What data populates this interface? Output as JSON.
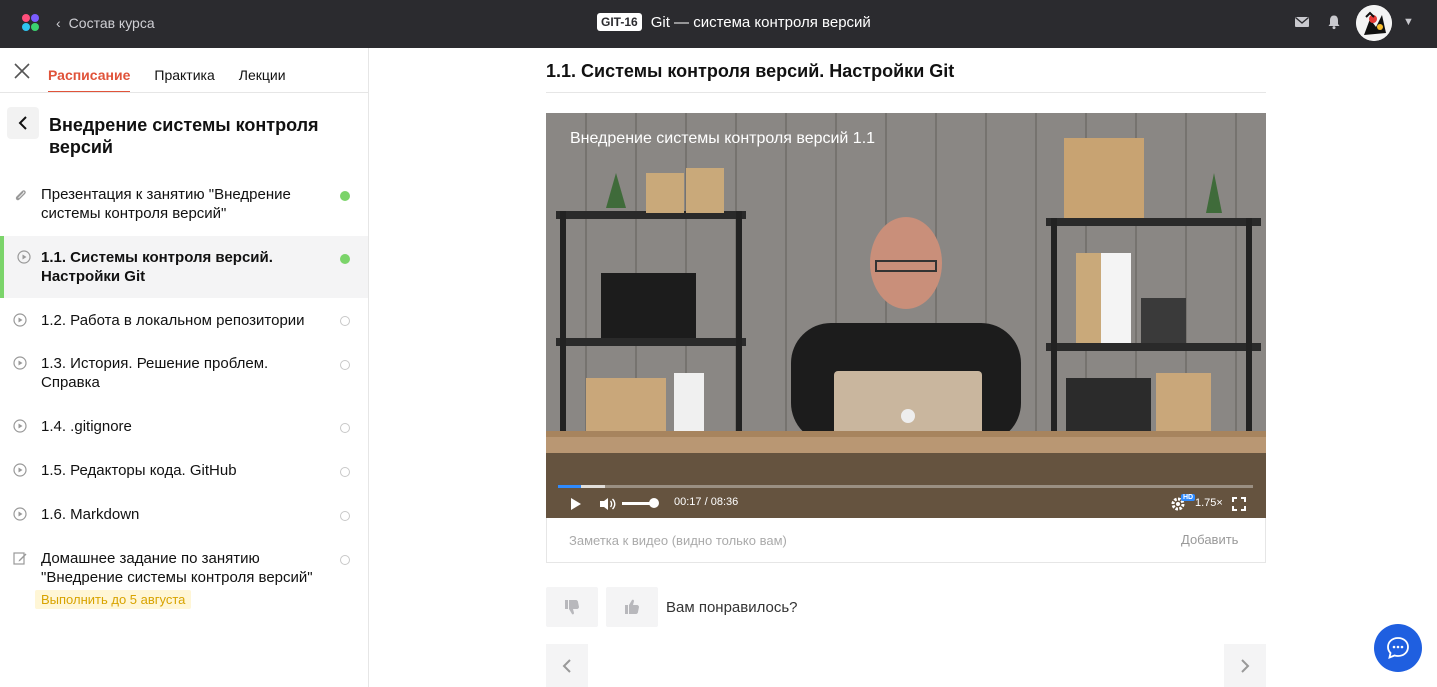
{
  "topbar": {
    "back_label": "Состав курса",
    "course_code": "GIT-16",
    "course_title": "Git — система контроля версий",
    "icons": [
      "logo-icon",
      "mail-icon",
      "bell-icon",
      "avatar",
      "chevron-down-icon"
    ]
  },
  "sidebar": {
    "tabs": [
      {
        "label": "Расписание",
        "active": true
      },
      {
        "label": "Практика",
        "active": false
      },
      {
        "label": "Лекции",
        "active": false
      }
    ],
    "section_title": "Внедрение системы контроля версий",
    "lessons": [
      {
        "label": "Презентация к занятию \"Внедрение системы контроля версий\"",
        "icon": "paperclip-icon",
        "status": "done"
      },
      {
        "label": "1.1. Системы контроля версий. Настройки Git",
        "icon": "play-icon",
        "status": "done",
        "active": true
      },
      {
        "label": "1.2. Работа в локальном репозитории",
        "icon": "play-icon",
        "status": "todo"
      },
      {
        "label": "1.3. История. Решение проблем. Справка",
        "icon": "play-icon",
        "status": "todo"
      },
      {
        "label": "1.4. .gitignore",
        "icon": "play-icon",
        "status": "todo"
      },
      {
        "label": "1.5. Редакторы кода. GitHub",
        "icon": "play-icon",
        "status": "todo"
      },
      {
        "label": "1.6. Markdown",
        "icon": "play-icon",
        "status": "todo"
      },
      {
        "label": "Домашнее задание по занятию \"Внедрение системы контроля версий\"",
        "icon": "edit-icon",
        "status": "todo"
      }
    ],
    "deadline": "Выполнить до 5 августа"
  },
  "main": {
    "lesson_heading": "1.1. Системы контроля версий. Настройки Git",
    "video": {
      "title": "Внедрение системы контроля версий 1.1",
      "time_current": "00:17",
      "time_total": "08:36",
      "speed": "1.75×",
      "quality_badge": "HD",
      "progress": 0.033,
      "buffered": 0.068,
      "volume": 0.9
    },
    "note": {
      "placeholder": "Заметка к видео (видно только вам)",
      "add_label": "Добавить"
    },
    "feedback_question": "Вам понравилось?"
  },
  "colors": {
    "accent": "#e0533a",
    "done": "#7bd46a",
    "chat": "#1f5fe0",
    "topbar": "#2b2b2f"
  }
}
